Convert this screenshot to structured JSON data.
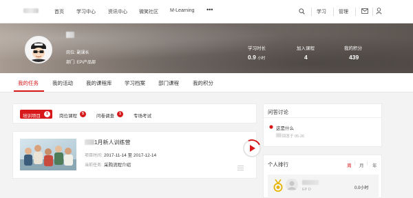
{
  "topnav": {
    "items": [
      "首页",
      "学习中心",
      "资讯中心",
      "微笑社区",
      "M-Learning"
    ],
    "more": "•••",
    "study": "学习",
    "manage": "管理"
  },
  "profile": {
    "position": "岗位: 副课长",
    "department": "部门: EPI产品部"
  },
  "stats": [
    {
      "label": "学习时长",
      "value": "0.9",
      "unit": "小时"
    },
    {
      "label": "加入课程",
      "value": "4",
      "unit": ""
    },
    {
      "label": "我的积分",
      "value": "439",
      "unit": ""
    }
  ],
  "tabs": [
    "我的任务",
    "我的活动",
    "我的课程库",
    "学习档案",
    "部门课程",
    "我的积分"
  ],
  "subtabs": [
    {
      "label": "培训项目",
      "count": "1"
    },
    {
      "label": "岗位课程",
      "count": "5"
    },
    {
      "label": "问卷调查",
      "count": "1"
    },
    {
      "label": "专场考试",
      "count": ""
    }
  ],
  "course": {
    "title": "1月新人训练营",
    "time_label": "项目时间:",
    "time_start": "2017-11-14",
    "time_sep": "至",
    "time_end": "2017-12-14",
    "task_label": "当前任务:",
    "task": "采购流程介绍"
  },
  "qa": {
    "title": "问答讨论",
    "question": "这是什么",
    "meta": "回答于 05-26"
  },
  "rank": {
    "title": "个人排行",
    "periods": [
      "周",
      "月",
      "年"
    ],
    "dept": "EP D",
    "hours": "0.0小时"
  },
  "colors": {
    "accent": "#d7191b"
  }
}
